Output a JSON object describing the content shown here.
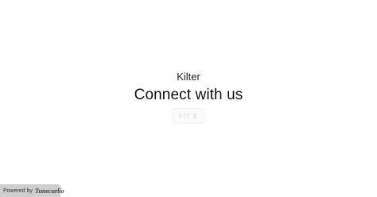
{
  "hero": {
    "brand": "Kilter",
    "title": "Connect with us",
    "cta_label": "FIT E"
  },
  "footer": {
    "powered_by": "Powered by",
    "logo_text": "Tunecurlio"
  }
}
